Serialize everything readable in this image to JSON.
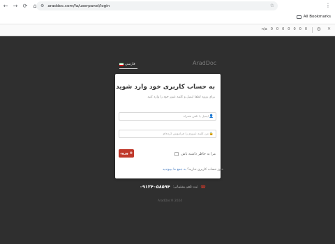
{
  "browser": {
    "url": "araddoc.com/fa/userpanel/login",
    "bookmarks_label": "All Bookmarks",
    "extensions": [
      "n/a",
      "0",
      "0",
      "0",
      "0",
      "0",
      "0",
      "0"
    ]
  },
  "page": {
    "brand": "AradDoc",
    "language_label": "فارسی",
    "card": {
      "title": "به حساب کاربری خود وارد شوید",
      "subtitle": "برای ورود لطفا ایمیل و کلمه عبور خود را وارد کنید",
      "email_placeholder": "ایمیل یا تلفن همراه",
      "password_placeholder": "کلمه عبور",
      "password_hint": "من کلمه عبورم را فراموش کرده‌ام",
      "remember_label": "مرا به خاطر داشته باش",
      "login_label": "ورود",
      "register_text": "هنوز حساب کاربری ندارید؟",
      "register_link": "به جمع ما بپیوندید"
    },
    "support_label": "ثبت تلفن پشتیبانی:",
    "support_number": "۰۹۱۲۴۰۵۸۵۹۴",
    "copyright": "AradDoc® 2024"
  },
  "colors": {
    "accent": "#c0392b",
    "background": "#2f2f2f",
    "card": "#ffffff"
  }
}
